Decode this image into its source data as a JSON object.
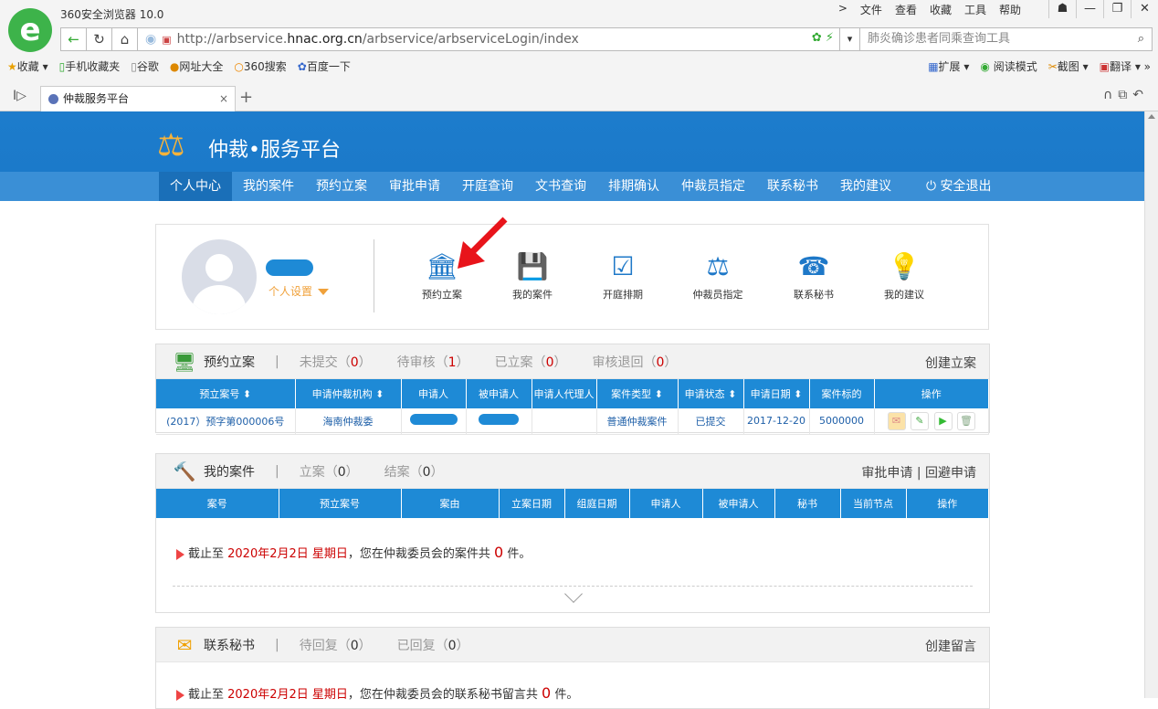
{
  "browser": {
    "title": "360安全浏览器 10.0",
    "menu": [
      "文件",
      "查看",
      "收藏",
      "工具",
      "帮助"
    ],
    "url_prefix": "http://arbservice.",
    "url_host": "hnac.org.cn",
    "url_path": "/arbservice/arbserviceLogin/index",
    "search_placeholder": "肺炎确诊患者同乘查询工具",
    "bookmarks": [
      "收藏",
      "手机收藏夹",
      "谷歌",
      "网址大全",
      "360搜索",
      "百度一下"
    ],
    "bookmarks_right": [
      "扩展",
      "阅读模式",
      "截图",
      "翻译"
    ],
    "tab_title": "仲裁服务平台"
  },
  "site": {
    "title": "仲裁•服务平台",
    "nav": [
      "个人中心",
      "我的案件",
      "预约立案",
      "审批申请",
      "开庭查询",
      "文书查询",
      "排期确认",
      "仲裁员指定",
      "联系秘书",
      "我的建议"
    ],
    "logout": "安全退出"
  },
  "profile": {
    "settings": "个人设置",
    "quick_links": [
      "预约立案",
      "我的案件",
      "开庭排期",
      "仲裁员指定",
      "联系秘书",
      "我的建议"
    ]
  },
  "panel_filing": {
    "title": "预约立案",
    "counts": [
      {
        "label": "未提交（",
        "value": "0",
        "end": "）"
      },
      {
        "label": "待审核（",
        "value": "1",
        "end": "）"
      },
      {
        "label": "已立案（",
        "value": "0",
        "end": "）"
      },
      {
        "label": "审核退回（",
        "value": "0",
        "end": "）"
      }
    ],
    "action": "创建立案",
    "columns": [
      "预立案号 ⬍",
      "申请仲裁机构 ⬍",
      "申请人",
      "被申请人",
      "申请人代理人",
      "案件类型 ⬍",
      "申请状态 ⬍",
      "申请日期 ⬍",
      "案件标的",
      "操作"
    ],
    "row": {
      "case_no": "(2017）预字第000006号",
      "institution": "海南仲裁委",
      "type": "普通仲裁案件",
      "status": "已提交",
      "date": "2017-12-20",
      "amount": "5000000"
    }
  },
  "panel_cases": {
    "title": "我的案件",
    "counts": [
      {
        "label": "立案（",
        "value": "0",
        "end": "）"
      },
      {
        "label": "结案（",
        "value": "0",
        "end": "）"
      }
    ],
    "action": "审批申请 | 回避申请",
    "columns": [
      "案号",
      "预立案号",
      "案由",
      "立案日期",
      "组庭日期",
      "申请人",
      "被申请人",
      "秘书",
      "当前节点",
      "操作"
    ],
    "notice_pre": "截止至 ",
    "notice_date": "2020年2月2日 星期日",
    "notice_mid": "，您在仲裁委员会的案件共 ",
    "notice_count": "0",
    "notice_end": " 件。"
  },
  "panel_secretary": {
    "title": "联系秘书",
    "counts": [
      {
        "label": "待回复（",
        "value": "0",
        "end": "）"
      },
      {
        "label": "已回复（",
        "value": "0",
        "end": "）"
      }
    ],
    "action": "创建留言",
    "notice_pre": "截止至 ",
    "notice_date": "2020年2月2日 星期日",
    "notice_mid": "，您在仲裁委员会的联系秘书留言共 ",
    "notice_count": "0",
    "notice_end": " 件。"
  }
}
